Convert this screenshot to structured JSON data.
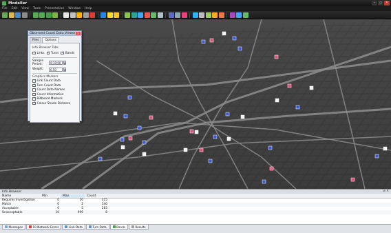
{
  "window": {
    "title": "Modeller",
    "controls": [
      "–",
      "▫",
      "✕"
    ]
  },
  "menu": {
    "items": [
      "File",
      "Edit",
      "View",
      "Tools",
      "Presentation",
      "Window",
      "Help"
    ]
  },
  "toolbar": {
    "icons": [
      {
        "name": "new-icon",
        "color": "#6aa84f"
      },
      {
        "name": "open-icon",
        "color": "#e0b84a"
      },
      {
        "name": "save-icon",
        "color": "#4a86c8"
      },
      {
        "name": "print-icon",
        "color": "#8a8a8a"
      },
      {
        "name": "sep"
      },
      {
        "name": "zoom-in-icon",
        "color": "#4caf50"
      },
      {
        "name": "zoom-out-icon",
        "color": "#4caf50"
      },
      {
        "name": "zoom-fit-icon",
        "color": "#43a047"
      },
      {
        "name": "refresh-icon",
        "color": "#7cb342"
      },
      {
        "name": "sep"
      },
      {
        "name": "select-icon",
        "color": "#e6e6e6"
      },
      {
        "name": "pan-icon",
        "color": "#c0c0c0"
      },
      {
        "name": "rotate-icon",
        "color": "#ffb300"
      },
      {
        "name": "measure-icon",
        "color": "#9e9e9e"
      },
      {
        "name": "stop-icon",
        "color": "#e53935"
      },
      {
        "name": "sep"
      },
      {
        "name": "layer-icon",
        "color": "#1e88e5"
      },
      {
        "name": "sun-icon",
        "color": "#fdd835"
      },
      {
        "name": "bulb-icon",
        "color": "#fbc02d"
      },
      {
        "name": "sep"
      },
      {
        "name": "route-icon",
        "color": "#8bc34a"
      },
      {
        "name": "network-icon",
        "color": "#26a69a"
      },
      {
        "name": "node-icon",
        "color": "#42a5f5"
      },
      {
        "name": "vehicle-icon",
        "color": "#ef5350"
      },
      {
        "name": "signal-icon",
        "color": "#66bb6a"
      },
      {
        "name": "table-icon",
        "color": "#b0bec5"
      },
      {
        "name": "sep"
      },
      {
        "name": "chart-icon",
        "color": "#5c6bc0"
      },
      {
        "name": "camera-icon",
        "color": "#90a4ae"
      },
      {
        "name": "record-icon",
        "color": "#ec407a"
      },
      {
        "name": "sep"
      },
      {
        "name": "view3d-icon",
        "color": "#29b6f6"
      },
      {
        "name": "settings-icon",
        "color": "#bdbdbd"
      },
      {
        "name": "grid-icon",
        "color": "#9ccc65"
      },
      {
        "name": "clock-icon",
        "color": "#ffa726"
      },
      {
        "name": "flag-icon",
        "color": "#ff7043"
      },
      {
        "name": "sep"
      },
      {
        "name": "marker-icon",
        "color": "#ab47bc"
      },
      {
        "name": "info-icon",
        "color": "#42a5f5"
      },
      {
        "name": "help-icon",
        "color": "#66bb6a"
      }
    ]
  },
  "dialog": {
    "title": "Observed Count Data Viewer",
    "tabs": [
      "Files",
      "Options"
    ],
    "info_browser_tabs_label": "Info Browser Tabs",
    "tab_checks": [
      {
        "label": "Links",
        "checked": true
      },
      {
        "label": "Turns",
        "checked": true
      },
      {
        "label": "Bands",
        "checked": true
      }
    ],
    "sample_period_label": "Sample Period:",
    "sample_period_value": "0:10:00",
    "weight_label": "Weight:",
    "weight_value": "0.50",
    "graphics_markers_label": "Graphics Markers",
    "marker_checks": [
      {
        "label": "Link Count Data",
        "checked": true
      },
      {
        "label": "Turn Count Data",
        "checked": true
      },
      {
        "label": "Count Data Names",
        "checked": false
      },
      {
        "label": "Count Information",
        "checked": false
      },
      {
        "label": "Billboard Markers",
        "checked": true
      },
      {
        "label": "Colour Shade Distance",
        "checked": true
      }
    ]
  },
  "info_browser": {
    "title": "Info Browser",
    "controls": "ø ✕",
    "columns": [
      "Name",
      "Min",
      "Max",
      "Count"
    ],
    "rows": [
      {
        "name": "Requires Investigation",
        "min": "0",
        "max": "10",
        "count": "315"
      },
      {
        "name": "Match",
        "min": "0",
        "max": "2",
        "count": "140"
      },
      {
        "name": "Acceptable",
        "min": "0",
        "max": "5",
        "count": "283"
      },
      {
        "name": "Unacceptable",
        "min": "10",
        "max": "999",
        "count": "8"
      }
    ]
  },
  "bottom_tabs": [
    {
      "label": "Messages",
      "icon": "messages-icon",
      "color": "#7aa7d6",
      "active": false
    },
    {
      "label": "10 Network Errors",
      "icon": "error-icon",
      "color": "#e53935",
      "active": false
    },
    {
      "label": "Link Data",
      "icon": "link-data-icon",
      "color": "#5c8fd6",
      "active": false
    },
    {
      "label": "Turn Data",
      "icon": "turn-data-icon",
      "color": "#5c8fd6",
      "active": false
    },
    {
      "label": "Bands",
      "icon": "bands-icon",
      "color": "#43a047",
      "active": true
    },
    {
      "label": "Results",
      "icon": "results-icon",
      "color": "#9e9e9e",
      "active": false
    }
  ],
  "map": {
    "background": "#3b3b3b",
    "road_color": "#8d8d8d",
    "marker_colors": {
      "blue": "#3b5bd9",
      "pink": "#e0507a",
      "white": "#f2f2f2"
    }
  }
}
